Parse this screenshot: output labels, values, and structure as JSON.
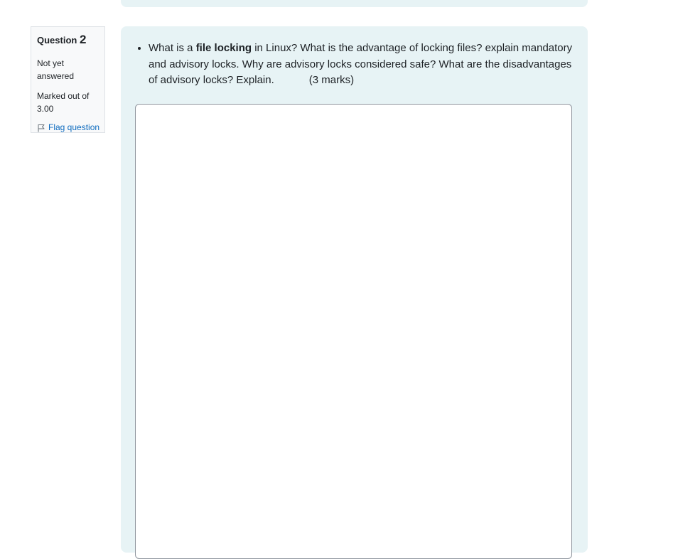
{
  "question_info": {
    "label": "Question",
    "number": "2",
    "state": "Not yet answered",
    "grade": "Marked out of 3.00",
    "flag_label": "Flag question"
  },
  "question_text": {
    "part1": "What is a ",
    "bold": "file locking",
    "part2": " in Linux? What is the advantage of locking files? explain mandatory and advisory locks. Why are advisory locks considered safe? What are the disadvantages of advisory locks? Explain.",
    "marks": "(3 marks)"
  },
  "answer": {
    "value": ""
  }
}
